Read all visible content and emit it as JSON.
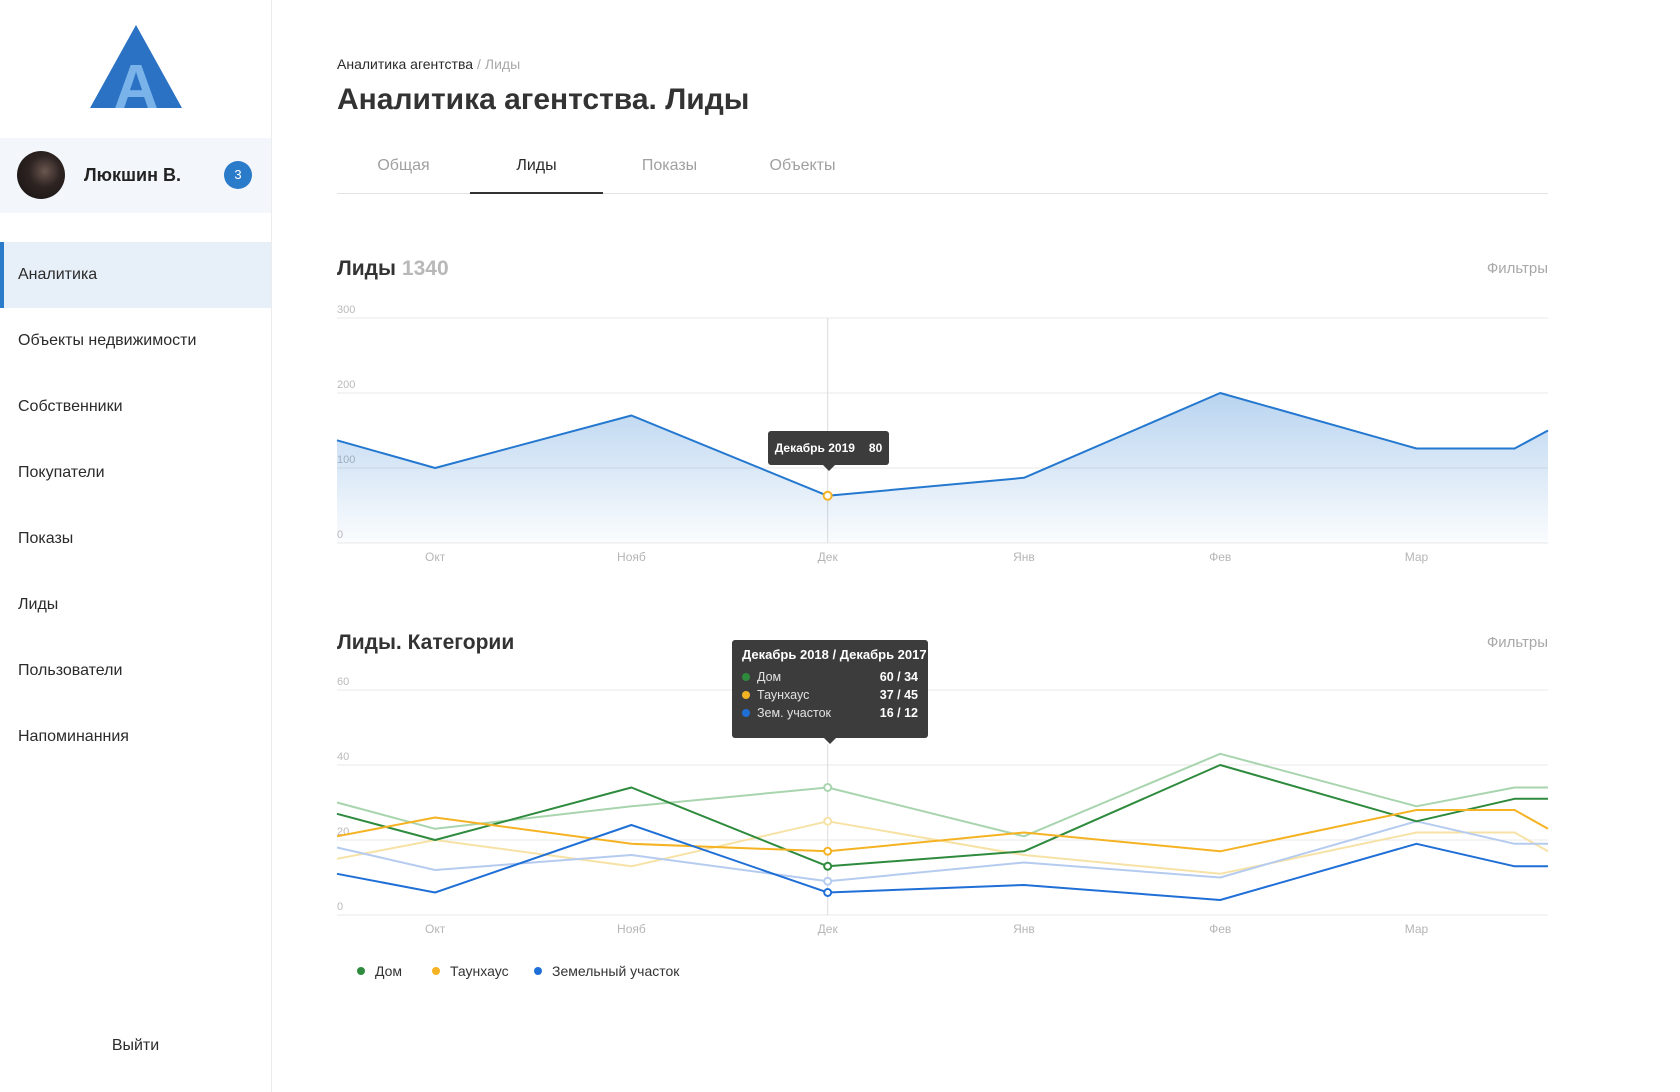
{
  "logo": {
    "letter": "A"
  },
  "user": {
    "name": "Люкшин В.",
    "badge": "3"
  },
  "nav": {
    "items": [
      {
        "label": "Аналитика",
        "active": true
      },
      {
        "label": "Объекты недвижимости"
      },
      {
        "label": "Собственники"
      },
      {
        "label": "Покупатели"
      },
      {
        "label": "Показы"
      },
      {
        "label": "Лиды"
      },
      {
        "label": "Пользователи"
      },
      {
        "label": "Напоминанния"
      }
    ]
  },
  "logout": "Выйти",
  "breadcrumb": {
    "parent": "Аналитика агентства",
    "separator": "/",
    "current": "Лиды"
  },
  "page_title": "Аналитика агентства. Лиды",
  "tabs": {
    "items": [
      {
        "label": "Общая"
      },
      {
        "label": "Лиды",
        "active": true
      },
      {
        "label": "Показы"
      },
      {
        "label": "Объекты"
      }
    ]
  },
  "leads": {
    "title": "Лиды",
    "total": "1340",
    "filters": "Фильтры",
    "tooltip": {
      "label": "Декабрь 2019",
      "value": "80"
    }
  },
  "categories": {
    "title": "Лиды. Категории",
    "filters": "Фильтры",
    "tooltip": {
      "title": "Декабрь 2018 / Декабрь 2017",
      "rows": [
        {
          "label": "Дом",
          "value": "60 / 34"
        },
        {
          "label": "Таунхаус",
          "value": "37 / 45"
        },
        {
          "label": "Зем. участок",
          "value": "16 / 12"
        }
      ]
    },
    "legend": [
      {
        "label": "Дом"
      },
      {
        "label": "Таунхаус"
      },
      {
        "label": "Земельный участок"
      }
    ]
  },
  "colors": {
    "accent": "#2b7bcb",
    "logo": "#2b72c4",
    "logo_letter": "#7ab3ea",
    "active_nav_bg": "#e7eff9",
    "tooltip_bg": "#3c3c3c"
  },
  "chart_data": [
    {
      "type": "area",
      "title": "Лиды",
      "xlim": [
        0.5,
        6.67
      ],
      "ylim": [
        0,
        300
      ],
      "y_ticks": [
        0,
        100,
        200,
        300
      ],
      "x_ticks": [
        1,
        2,
        3,
        4,
        5,
        6
      ],
      "tick_labels": [
        "Окт",
        "Нояб",
        "Дек",
        "Янв",
        "Фев",
        "Мар"
      ],
      "x": [
        0.5,
        1,
        2,
        3,
        4,
        5,
        6,
        6.5,
        6.67
      ],
      "series": [
        {
          "values": [
            137,
            100,
            170,
            63,
            87,
            200,
            126,
            126,
            150
          ],
          "color": "#2478cf"
        }
      ],
      "highlight": {
        "x": 3,
        "color": "#f5b324"
      },
      "grid": true
    },
    {
      "type": "line",
      "title": "Лиды. Категории",
      "xlim": [
        0.5,
        6.67
      ],
      "ylim": [
        0,
        60
      ],
      "y_ticks": [
        0,
        20,
        40,
        60
      ],
      "x_ticks": [
        1,
        2,
        3,
        4,
        5,
        6
      ],
      "tick_labels": [
        "Окт",
        "Нояб",
        "Дек",
        "Янв",
        "Фев",
        "Мар"
      ],
      "x": [
        0.5,
        1,
        2,
        3,
        4,
        5,
        6,
        6.5,
        6.67
      ],
      "series": [
        {
          "name": "Дом",
          "values": [
            27,
            20,
            34,
            13,
            17,
            40,
            25,
            31,
            31
          ],
          "previous": [
            30,
            23,
            29,
            34,
            21,
            43,
            29,
            34,
            34
          ],
          "color": "#2e8b3e",
          "color_previous": "#a8d5ae"
        },
        {
          "name": "Таунхаус",
          "values": [
            21,
            26,
            19,
            17,
            22,
            17,
            28,
            28,
            23
          ],
          "previous": [
            15,
            20,
            13,
            25,
            16,
            11,
            22,
            22,
            17
          ],
          "color": "#f5b324",
          "color_previous": "#f7e2a6"
        },
        {
          "name": "Земельный участок",
          "values": [
            11,
            6,
            24,
            6,
            8,
            4,
            19,
            13,
            13
          ],
          "previous": [
            18,
            12,
            16,
            9,
            14,
            10,
            25,
            19,
            19
          ],
          "color": "#1f6fd6",
          "color_previous": "#b5cbef"
        }
      ],
      "highlight": {
        "x": 3
      },
      "legend": "bottom-left",
      "grid": true
    }
  ]
}
